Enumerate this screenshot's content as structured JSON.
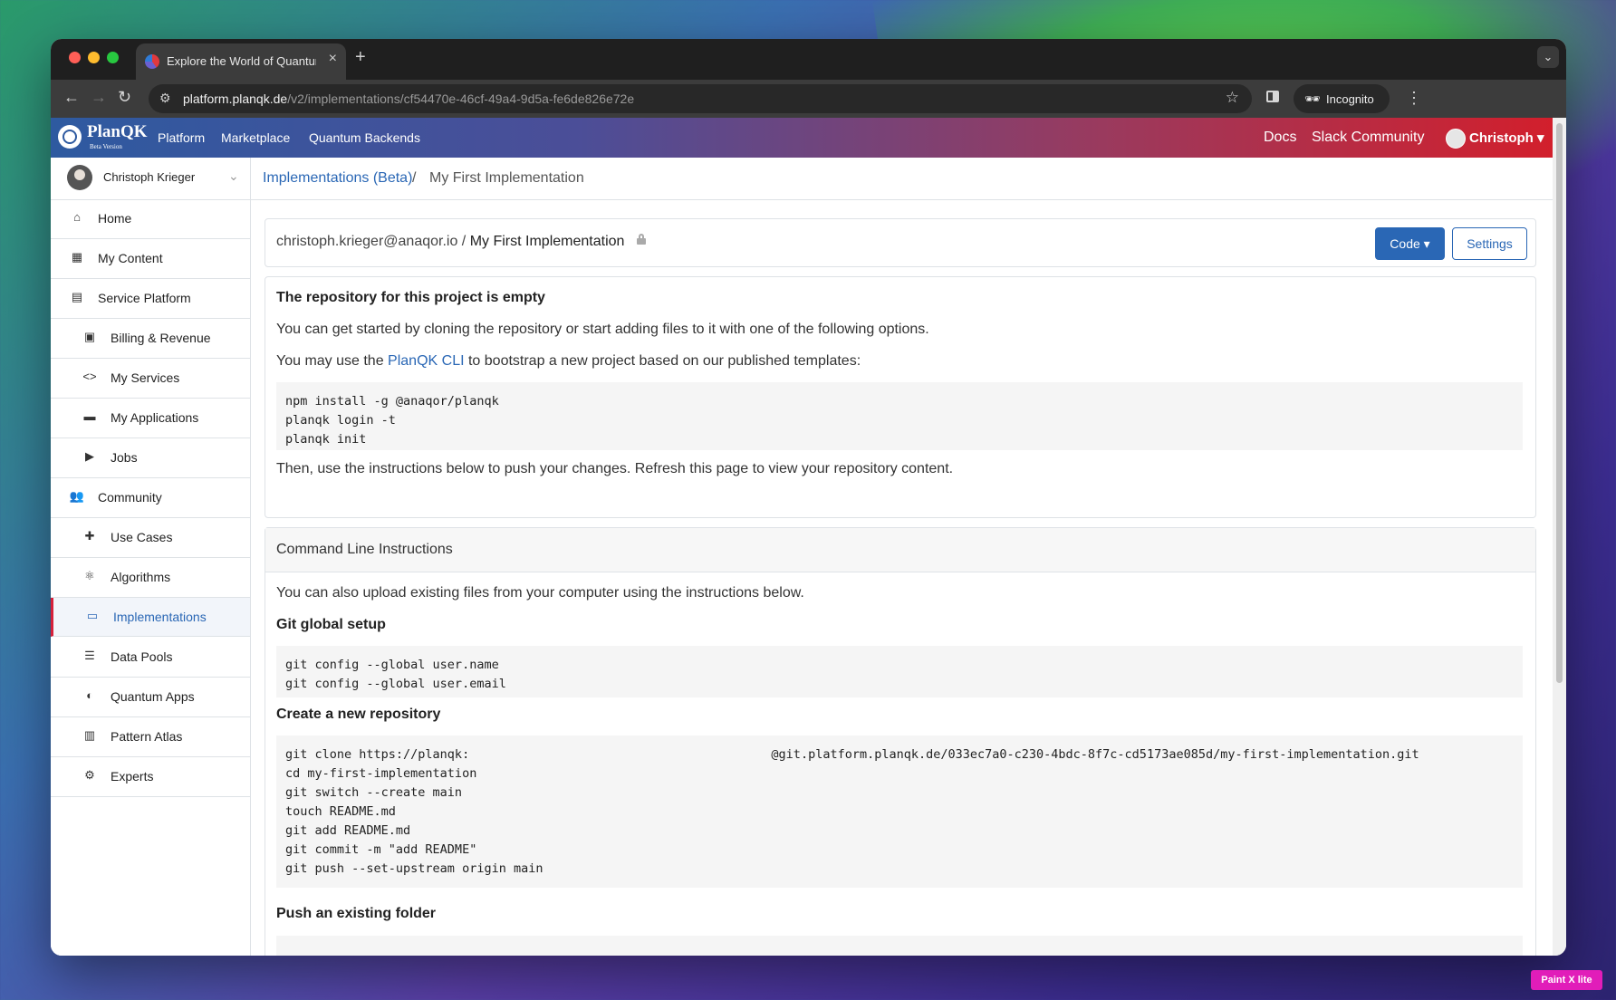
{
  "browser": {
    "tab_title": "Explore the World of Quantum",
    "url_host": "platform.planqk.de",
    "url_path": "/v2/implementations/cf54470e-46cf-49a4-9d5a-fe6de826e72e",
    "incognito_label": "Incognito"
  },
  "appbar": {
    "logo": "PlanQK",
    "logo_sub": "Beta Version",
    "nav": [
      "Platform",
      "Marketplace",
      "Quantum Backends"
    ],
    "right_links": [
      "Docs",
      "Slack Community"
    ],
    "user": "Christoph"
  },
  "sidebar": {
    "profile_name": "Christoph Krieger",
    "items": [
      {
        "label": "Home",
        "icon": "home-icon"
      },
      {
        "label": "My Content",
        "icon": "dashboard-icon"
      },
      {
        "label": "Service Platform",
        "icon": "grid-icon"
      },
      {
        "label": "Billing & Revenue",
        "icon": "wallet-icon"
      },
      {
        "label": "My Services",
        "icon": "code-icon"
      },
      {
        "label": "My Applications",
        "icon": "briefcase-icon"
      },
      {
        "label": "Jobs",
        "icon": "play-icon"
      },
      {
        "label": "Community",
        "icon": "people-icon"
      },
      {
        "label": "Use Cases",
        "icon": "puzzle-icon"
      },
      {
        "label": "Algorithms",
        "icon": "atom-icon"
      },
      {
        "label": "Implementations",
        "icon": "implementation-icon"
      },
      {
        "label": "Data Pools",
        "icon": "database-icon"
      },
      {
        "label": "Quantum Apps",
        "icon": "globe-icon"
      },
      {
        "label": "Pattern Atlas",
        "icon": "book-icon"
      },
      {
        "label": "Experts",
        "icon": "experts-icon"
      }
    ]
  },
  "breadcrumb": {
    "parent": "Implementations (Beta)",
    "separator": "/",
    "current": "My First Implementation"
  },
  "repo": {
    "owner": "christoph.krieger@anaqor.io",
    "separator": " / ",
    "name": "My First Implementation",
    "code_button": "Code",
    "settings_button": "Settings"
  },
  "empty_state": {
    "heading": "The repository for this project is empty",
    "intro": "You can get started by cloning the repository or start adding files to it with one of the following options.",
    "cli_prefix": "You may use the ",
    "cli_link": "PlanQK CLI",
    "cli_suffix": " to bootstrap a new project based on our published templates:",
    "cli_code": [
      "npm install -g @anaqor/planqk",
      "planqk login -t",
      "planqk init"
    ],
    "outro": "Then, use the instructions below to push your changes. Refresh this page to view your repository content."
  },
  "cli_instructions": {
    "title": "Command Line Instructions",
    "intro": "You can also upload existing files from your computer using the instructions below.",
    "git_global_heading": "Git global setup",
    "git_global_code": [
      "git config --global user.name",
      "git config --global user.email"
    ],
    "new_repo_heading": "Create a new repository",
    "new_repo_code": [
      "git clone https://planqk:                                         @git.platform.planqk.de/033ec7a0-c230-4bdc-8f7c-cd5173ae085d/my-first-implementation.git",
      "cd my-first-implementation",
      "git switch --create main",
      "touch README.md",
      "git add README.md",
      "git commit -m \"add README\"",
      "git push --set-upstream origin main"
    ],
    "existing_folder_heading": "Push an existing folder"
  },
  "watermark": "Paint X lite",
  "colors": {
    "accent": "#2a67b5",
    "active_marker": "#d6203a",
    "appbar_start": "#2e5aa0",
    "appbar_end": "#d21f2c"
  }
}
